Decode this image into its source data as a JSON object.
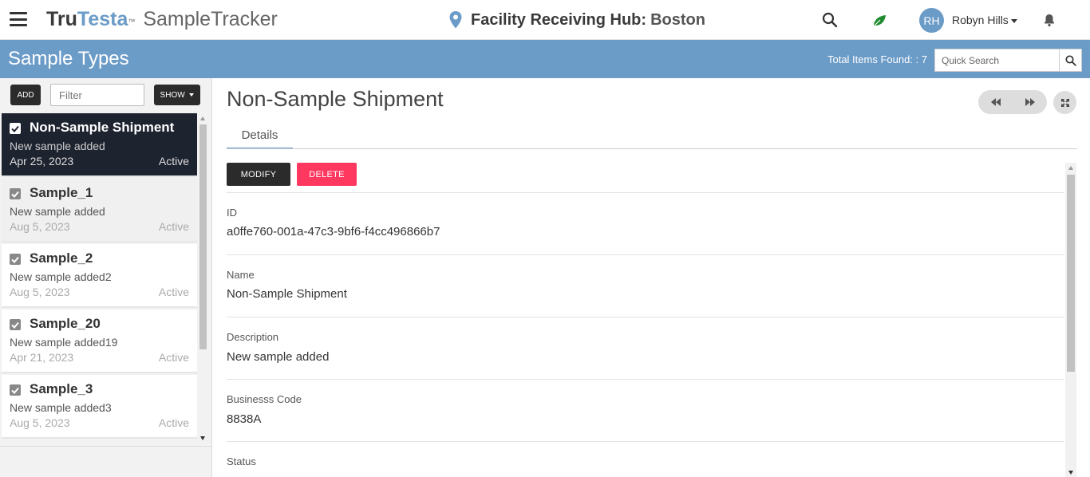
{
  "header": {
    "brand_tru": "Tru",
    "brand_testa": "Testa",
    "brand_tm": "™",
    "brand_app": "SampleTracker",
    "facility_name": "Facility Receiving Hub:",
    "facility_city": "Boston",
    "user_initials": "RH",
    "user_name": "Robyn Hills",
    "icons": [
      "menu-icon",
      "location-pin-icon",
      "search-icon",
      "leaf-icon",
      "caret-down-icon",
      "bell-icon"
    ]
  },
  "titlebar": {
    "page_title": "Sample Types",
    "total_found": "Total Items Found: : 7",
    "quick_search_placeholder": "Quick Search"
  },
  "sidebar": {
    "add_label": "ADD",
    "filter_placeholder": "Filter",
    "show_label": "SHOW",
    "items": [
      {
        "title": "Non-Sample Shipment",
        "desc": "New sample added",
        "date": "Apr 25, 2023",
        "status": "Active",
        "selected": true
      },
      {
        "title": "Sample_1",
        "desc": "New sample added",
        "date": "Aug 5, 2023",
        "status": "Active",
        "selected": false
      },
      {
        "title": "Sample_2",
        "desc": "New sample added2",
        "date": "Aug 5, 2023",
        "status": "Active",
        "selected": false
      },
      {
        "title": "Sample_20",
        "desc": "New sample added19",
        "date": "Apr 21, 2023",
        "status": "Active",
        "selected": false
      },
      {
        "title": "Sample_3",
        "desc": "New sample added3",
        "date": "Aug 5, 2023",
        "status": "Active",
        "selected": false
      }
    ]
  },
  "detail": {
    "title": "Non-Sample Shipment",
    "tab_details": "Details",
    "modify_label": "MODIFY",
    "delete_label": "DELETE",
    "fields": [
      {
        "label": "ID",
        "value": "a0ffe760-001a-47c3-9bf6-f4cc496866b7"
      },
      {
        "label": "Name",
        "value": "Non-Sample Shipment"
      },
      {
        "label": "Description",
        "value": "New sample added"
      },
      {
        "label": "Businesss Code",
        "value": "8838A"
      },
      {
        "label": "Status",
        "value": ""
      }
    ]
  },
  "colors": {
    "accent_blue": "#6b9bc7",
    "dark_button": "#2b2b2b",
    "delete_red": "#ff3860",
    "selected_item_bg": "#1e2330"
  }
}
